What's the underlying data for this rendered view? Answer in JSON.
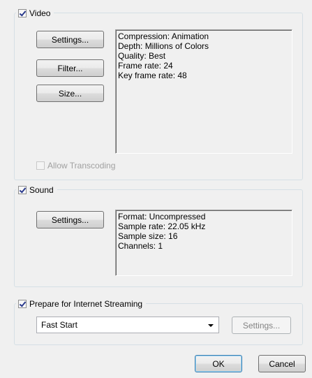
{
  "video": {
    "label": "Video",
    "checked": true,
    "buttons": {
      "settings": "Settings...",
      "filter": "Filter...",
      "size": "Size..."
    },
    "info": [
      "Compression: Animation",
      "Depth: Millions of Colors",
      "Quality: Best",
      "Frame rate: 24",
      "Key frame rate: 48"
    ],
    "allow_transcoding": {
      "label": "Allow Transcoding",
      "checked": false,
      "enabled": false
    }
  },
  "sound": {
    "label": "Sound",
    "checked": true,
    "buttons": {
      "settings": "Settings..."
    },
    "info": [
      "Format: Uncompressed",
      "Sample rate: 22.05 kHz",
      "Sample size: 16",
      "Channels: 1"
    ]
  },
  "streaming": {
    "label": "Prepare for Internet Streaming",
    "checked": true,
    "selected_option": "Fast Start",
    "settings_label": "Settings..."
  },
  "dialog": {
    "ok_label": "OK",
    "cancel_label": "Cancel"
  },
  "icons": {
    "checkbox_checked": "check-icon",
    "dropdown": "chevron-down-icon"
  }
}
